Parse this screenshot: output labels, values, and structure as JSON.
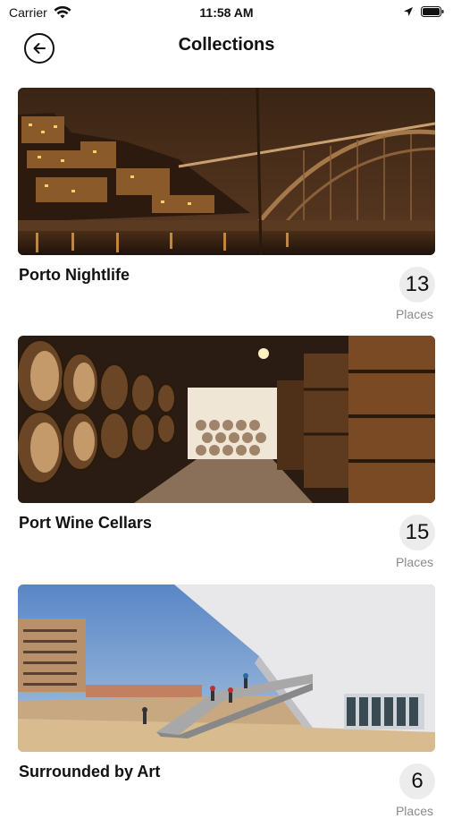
{
  "status_bar": {
    "carrier": "Carrier",
    "time": "11:58 AM",
    "wifi_icon": "wifi-icon",
    "location_icon": "location-arrow-icon",
    "battery_icon": "battery-icon"
  },
  "header": {
    "title": "Collections",
    "back_icon": "arrow-left-circle-icon"
  },
  "collections": [
    {
      "title": "Porto Nightlife",
      "count": "13",
      "count_label": "Places"
    },
    {
      "title": "Port Wine Cellars",
      "count": "15",
      "count_label": "Places"
    },
    {
      "title": "Surrounded by Art",
      "count": "6",
      "count_label": "Places"
    }
  ],
  "colors": {
    "background": "#ffffff",
    "text": "#111111",
    "count_bg": "#ececec",
    "muted": "#8a8a8a"
  }
}
